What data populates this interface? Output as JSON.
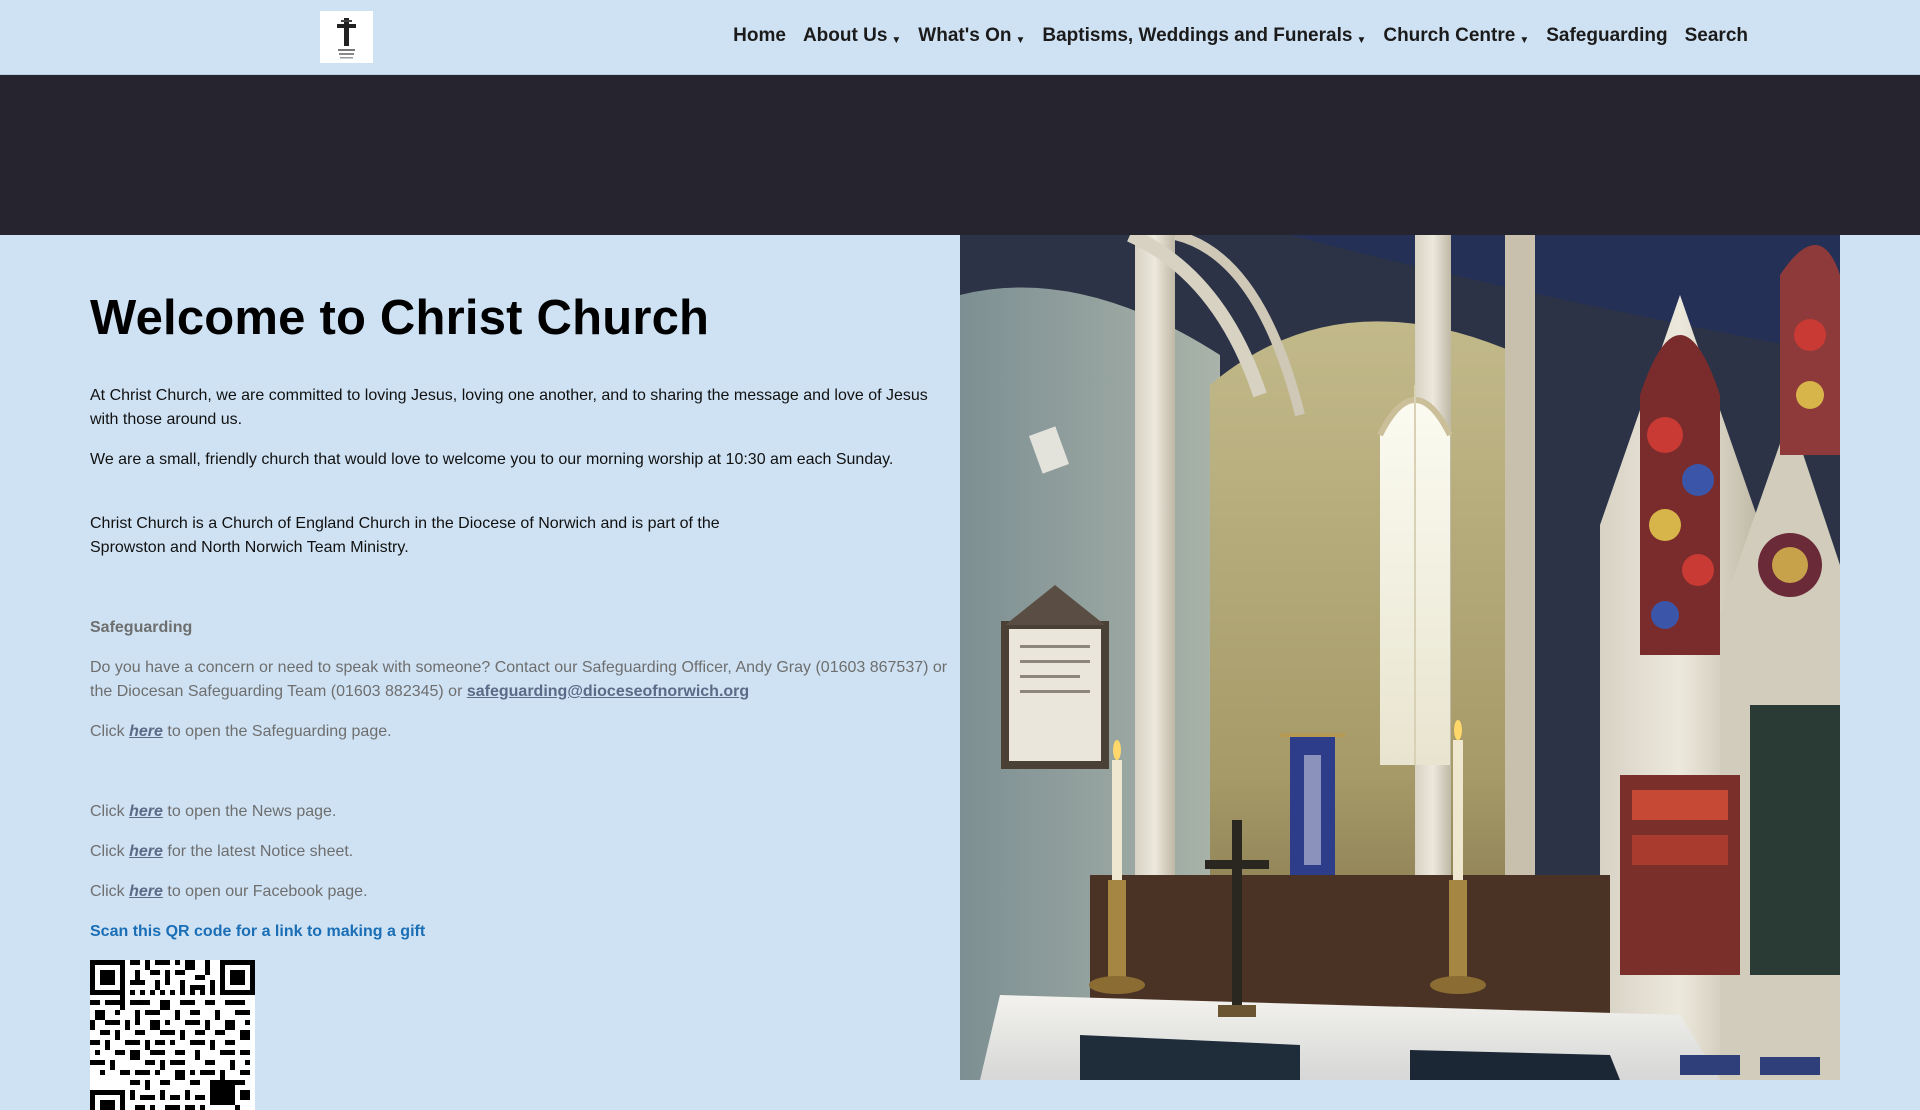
{
  "logo": {
    "alt": "Christ Church logo"
  },
  "nav": {
    "items": [
      {
        "label": "Home",
        "caret": ""
      },
      {
        "label": "About Us",
        "caret": "▼"
      },
      {
        "label": "What's On",
        "caret": "▼"
      },
      {
        "label": "Baptisms, Weddings and Funerals",
        "caret": "▼"
      },
      {
        "label": "Church Centre",
        "caret": "▼"
      },
      {
        "label": "Safeguarding",
        "caret": ""
      },
      {
        "label": "Search",
        "caret": ""
      }
    ]
  },
  "main": {
    "title": "Welcome to Christ Church",
    "intro_1": "At Christ Church, we are committed to loving Jesus, loving one another, and to sharing the message and love of Jesus with those around us.",
    "intro_2": "We are a small, friendly church that would love to welcome you to our morning worship at 10:30 am each Sunday.",
    "intro_3a": "Christ Church is a Church of England Church in the Diocese of Norwich and is part of the",
    "intro_3b": "Sprowston and North Norwich Team Ministry.",
    "safeguarding": {
      "heading": "Safeguarding",
      "text": "Do you have a concern or need to speak with someone? Contact our Safeguarding Officer, Andy Gray (01603 867537) or the Diocesan Safeguarding Team (01603 882345) or ",
      "email": "safeguarding@dioceseofnorwich.org"
    },
    "links": {
      "click": "Click",
      "here": "here",
      "safeguarding_rest": "to open the Safeguarding page.",
      "news_rest": "to open the News page.",
      "notice_rest": "for the latest Notice sheet.",
      "facebook_rest": "to open our Facebook page."
    },
    "gift": "Scan this QR code for a link to making a gift"
  },
  "colors": {
    "background": "#cfe2f3",
    "band": "#25242f",
    "link": "#5b6a86",
    "gift": "#1a6eb5"
  }
}
